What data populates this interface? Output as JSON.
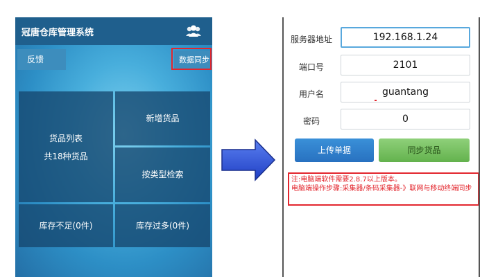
{
  "left_app": {
    "title": "冠唐仓库管理系统",
    "feedback_label": "反馈",
    "sync_data_label": "数据同步",
    "tiles": {
      "goods_list_line1": "货品列表",
      "goods_list_line2": "共18种货品",
      "add_goods": "新增货品",
      "search_by_type": "按类型检索",
      "low_stock": "库存不足(0件)",
      "over_stock": "库存过多(0件)"
    },
    "icons": {
      "users": "users-icon"
    }
  },
  "right_app": {
    "fields": [
      {
        "label": "服务器地址",
        "value": "192.168.1.24"
      },
      {
        "label": "端口号",
        "value": "2101"
      },
      {
        "label": "用户名",
        "value": "guantang"
      },
      {
        "label": "密码",
        "value": "0"
      }
    ],
    "upload_button": "上传单据",
    "sync_goods_button": "同步货品",
    "note_line1": "注:电脑端软件需要2.8.7以上版本。",
    "note_line2": "电脑端操作步骤:采集器/条码采集器-》联网与移动终端同步"
  },
  "colors": {
    "accent_blue": "#1f5f8d",
    "highlight_red": "#e3262d",
    "upload_blue": "#2f80cc",
    "sync_green": "#74bf5d",
    "arrow_blue": "#2b50d8"
  }
}
